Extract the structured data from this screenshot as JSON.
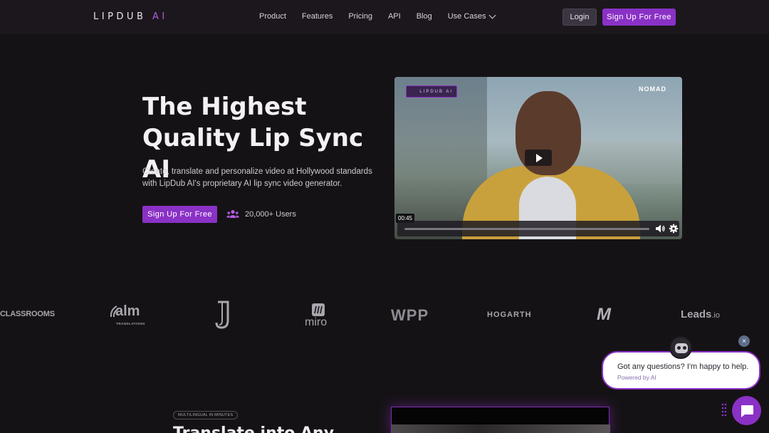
{
  "nav": {
    "logo_main": "LIPDUB",
    "logo_ai": "AI",
    "links": [
      "Product",
      "Features",
      "Pricing",
      "API",
      "Blog",
      "Use Cases"
    ],
    "login": "Login",
    "signup": "Sign Up For Free"
  },
  "hero": {
    "title_line1": "The Highest",
    "title_line2": "Quality Lip Sync AI",
    "subtitle": "Create, translate and personalize video at Hollywood standards with LipDub AI's proprietary AI lip sync video generator.",
    "cta": "Sign Up For Free",
    "users": "20,000+ Users",
    "accent": "#8a31c6"
  },
  "video": {
    "badge": "LIPDUB AI",
    "brand": "NOMAD",
    "time": "00:45",
    "progress_fraction": 0.0
  },
  "logos": [
    "CLASSROOMS",
    "alm",
    "TRANSLATIONS",
    "miro",
    "WPP",
    "HOGARTH",
    "M",
    "Leads",
    ".io"
  ],
  "section": {
    "tag": "MULTILINGUAL IN MINUTES",
    "title": "Translate into Any"
  },
  "chat": {
    "message": "Got any questions? I'm happy to help.",
    "powered": "Powered by AI",
    "close": "×"
  }
}
